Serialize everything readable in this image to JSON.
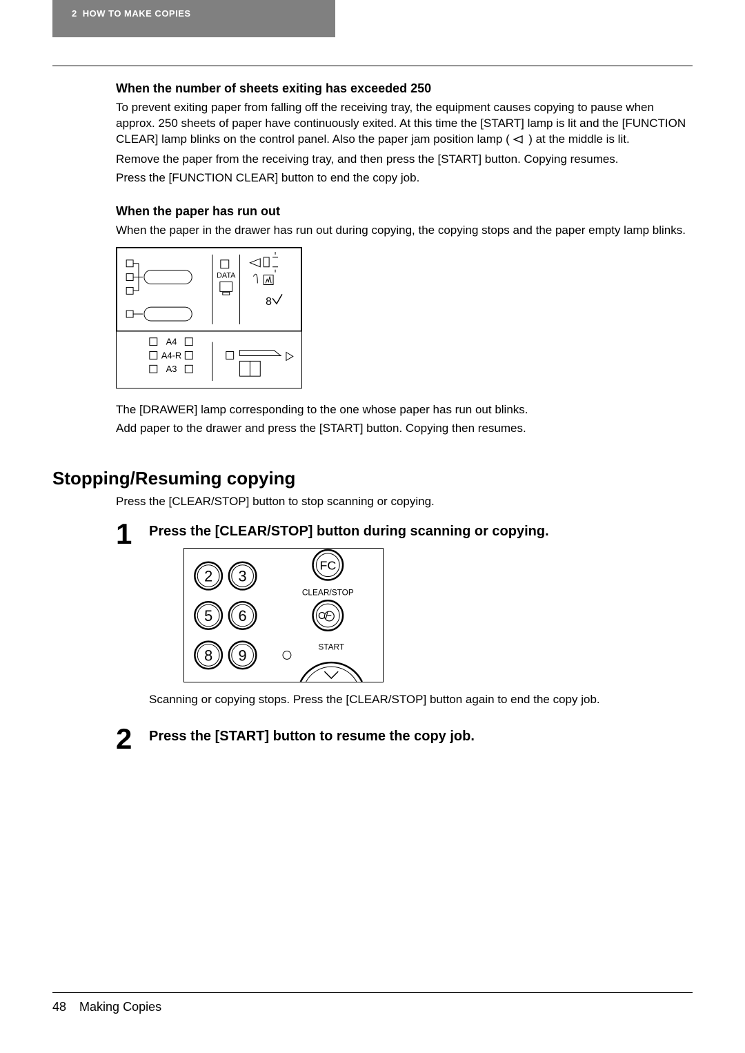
{
  "header": {
    "chapter_num": "2",
    "chapter_title": "HOW TO MAKE COPIES"
  },
  "sections": {
    "s1": {
      "heading": "When the number of sheets exiting has exceeded 250",
      "p1a": "To prevent exiting paper from falling off the receiving tray, the equipment causes copying to pause when approx. 250 sheets of paper have continuously exited. At this time the [START] lamp is lit and the [FUNCTION CLEAR] lamp blinks on the control panel. Also the paper jam position lamp (",
      "p1b": ") at the middle is lit.",
      "p2": "Remove the paper from the receiving tray, and then press the [START] button. Copying resumes.",
      "p3": "Press the [FUNCTION CLEAR] button to end the copy job."
    },
    "s2": {
      "heading": "When the paper has run out",
      "p1": "When the paper in the drawer has run out during copying, the copying stops and the paper empty lamp blinks.",
      "p2": "The [DRAWER] lamp corresponding to the one whose paper has run out blinks.",
      "p3": "Add paper to the drawer and press the [START] button. Copying then resumes."
    },
    "s3": {
      "heading": "Stopping/Resuming copying",
      "intro": "Press the [CLEAR/STOP] button to stop scanning or copying.",
      "step1": {
        "num": "1",
        "title": "Press the [CLEAR/STOP] button during scanning or copying.",
        "after": "Scanning or copying stops. Press the [CLEAR/STOP] button again to end the copy job."
      },
      "step2": {
        "num": "2",
        "title": "Press the [START] button to resume the copy job."
      }
    }
  },
  "diagram1": {
    "data_label": "DATA",
    "sizes": [
      "A4",
      "A4-R",
      "A3"
    ]
  },
  "diagram2": {
    "fc_label": "FC",
    "clear_stop_label": "CLEAR/STOP",
    "cstop_btn": "C/",
    "start_label": "START",
    "keys": [
      "2",
      "3",
      "5",
      "6",
      "8",
      "9"
    ]
  },
  "footer": {
    "page": "48",
    "title": "Making Copies"
  }
}
